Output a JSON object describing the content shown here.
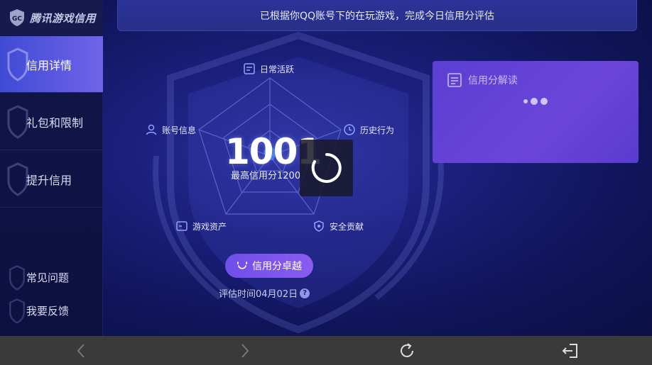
{
  "sidebar": {
    "brand": "腾讯游戏信用",
    "items": [
      {
        "label": "信用详情",
        "active": true
      },
      {
        "label": "礼包和限制",
        "active": false
      },
      {
        "label": "提升信用",
        "active": false
      }
    ],
    "bottom_items": [
      {
        "label": "常见问题"
      },
      {
        "label": "我要反馈"
      }
    ]
  },
  "banner": {
    "text": "已根据你QQ账号下的在玩游戏，完成今日信用分评估"
  },
  "radar": {
    "axes": [
      {
        "label": "日常活跃",
        "icon": "document-icon"
      },
      {
        "label": "历史行为",
        "icon": "clock-icon"
      },
      {
        "label": "安全贡献",
        "icon": "shield-icon"
      },
      {
        "label": "游戏资产",
        "icon": "wallet-icon"
      },
      {
        "label": "账号信息",
        "icon": "user-icon"
      }
    ]
  },
  "score": {
    "value": "1001",
    "max_label": "最高信用分1200"
  },
  "level_button": {
    "label": "信用分卓越",
    "icon": "smile-icon"
  },
  "eval_time": {
    "label": "评估时间04月02日",
    "help": "?"
  },
  "card": {
    "title": "信用分解读",
    "icon": "document-icon"
  },
  "colors": {
    "accent": "#6f4ee8",
    "sidebar_active": "#4f56dc",
    "card": "#5b3fd3",
    "radar_stroke": "#5a63c8"
  },
  "bottombar": {
    "icons": [
      "back-icon",
      "forward-icon",
      "refresh-icon",
      "exit-icon"
    ]
  }
}
